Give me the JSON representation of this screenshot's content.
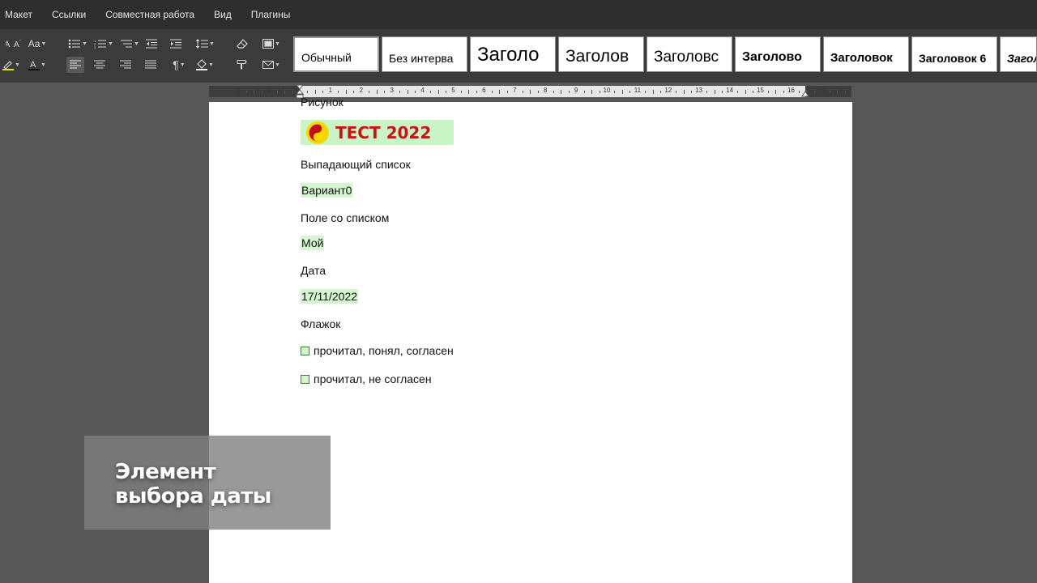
{
  "menu": [
    "Макет",
    "Ссылки",
    "Совместная работа",
    "Вид",
    "Плагины"
  ],
  "toolbar": {
    "font_size_label": "Aa",
    "paragraph_mark": "¶"
  },
  "styles": [
    {
      "label": "Обычный",
      "selected": true
    },
    {
      "label": "Без интерва"
    },
    {
      "label": "Заголо"
    },
    {
      "label": "Заголов"
    },
    {
      "label": "Заголовс"
    },
    {
      "label": "Заголово"
    },
    {
      "label": "Заголовок"
    },
    {
      "label": "Заголовок 6"
    },
    {
      "label": "Загол"
    }
  ],
  "ruler": {
    "numbers": [
      "2",
      "1",
      "1",
      "2",
      "3",
      "4",
      "5",
      "6",
      "7",
      "8",
      "9",
      "10",
      "11",
      "12",
      "13",
      "14",
      "15",
      "16",
      "17"
    ]
  },
  "document": {
    "cut_line": "Рисунок",
    "picture_text": "ТЕСТ 2022",
    "dropdown_label": "Выпадающий список",
    "dropdown_value": "Вариант0",
    "combobox_label": "Поле со списком",
    "combobox_value": "Мой",
    "date_label": "Дата",
    "date_value": "17/11/2022",
    "checkbox_label": "Флажок",
    "checkbox1": "прочитал, понял, согласен",
    "checkbox2": "прочитал, не согласен"
  },
  "caption": {
    "line1": "Элемент",
    "line2": "выбора даты"
  },
  "colors": {
    "field_highlight": "#d4f5cf",
    "picture_background": "#c9f4c5",
    "picture_text": "#c81414",
    "highlight_underline": "#f0e000"
  }
}
